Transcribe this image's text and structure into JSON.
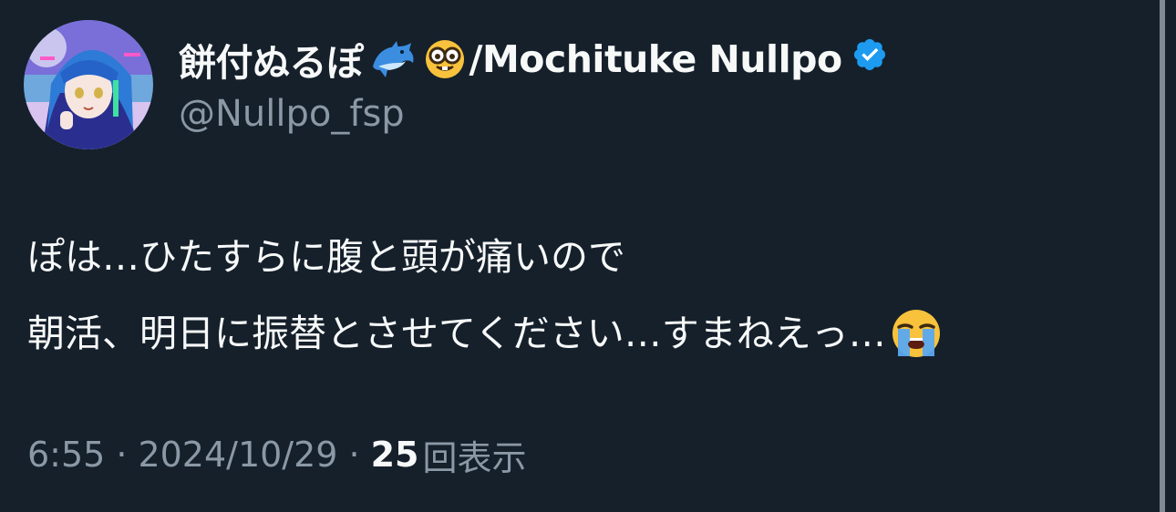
{
  "author": {
    "display_name_prefix": "餅付ぬるぽ",
    "display_name_emojis": [
      "dolphin-emoji",
      "nerd-face-emoji"
    ],
    "display_name_suffix": "/Mochituke Nullpo",
    "verified": true,
    "handle": "@Nullpo_fsp",
    "avatar": "anime-character-avatar"
  },
  "tweet": {
    "line1": "ぽは…ひたすらに腹と頭が痛いので",
    "line2": "朝活、明日に振替とさせてください…すまねえっ…",
    "line2_emoji": "loudly-crying-face-emoji"
  },
  "meta": {
    "time": "6:55",
    "separator": "·",
    "date": "2024/10/29",
    "views_count": "25",
    "views_label": "回表示"
  },
  "colors": {
    "background": "#15202b",
    "primary_text": "#f7f9f9",
    "secondary_text": "#8b98a5",
    "verified_badge": "#1d9bf0"
  }
}
